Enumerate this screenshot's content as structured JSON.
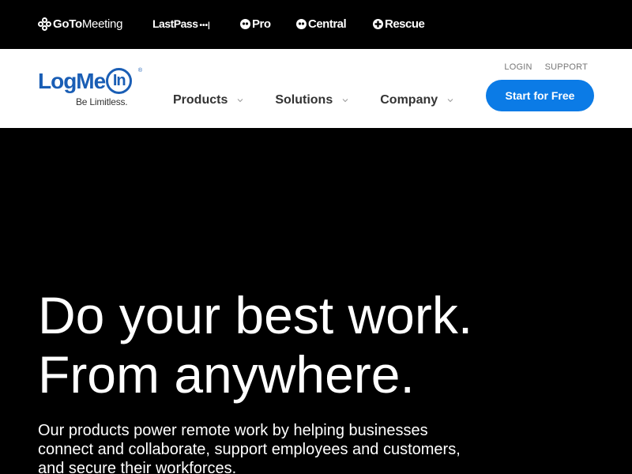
{
  "brandbar": {
    "gotomeeting": {
      "bold": "GoTo",
      "regular": "Meeting"
    },
    "lastpass": {
      "text": "LastPass",
      "dots": "•••|"
    },
    "pro": {
      "text": "Pro"
    },
    "central": {
      "text": "Central"
    },
    "rescue": {
      "text": "Rescue"
    }
  },
  "header": {
    "logo": {
      "text": "LogMe",
      "in": "In",
      "reg": "®",
      "tagline": "Be Limitless."
    },
    "nav": [
      {
        "label": "Products"
      },
      {
        "label": "Solutions"
      },
      {
        "label": "Company"
      }
    ],
    "utility": {
      "login": "LOGIN",
      "support": "SUPPORT"
    },
    "cta": "Start for Free"
  },
  "hero": {
    "headline_line1": "Do your best work.",
    "headline_line2": "From anywhere.",
    "subtext": "Our products power remote work by helping businesses connect and collaborate, support employees and customers, and secure their workforces."
  },
  "icons": {
    "gotomeeting": "flower-icon",
    "pro": "logmein-circle-icon",
    "central": "logmein-circle-icon",
    "rescue": "plus-circle-icon",
    "nav_chevron": "chevron-down-icon"
  },
  "colors": {
    "brand_blue": "#1a5eb5",
    "cta_blue": "#0b7be6",
    "hero_bg": "#000000"
  }
}
